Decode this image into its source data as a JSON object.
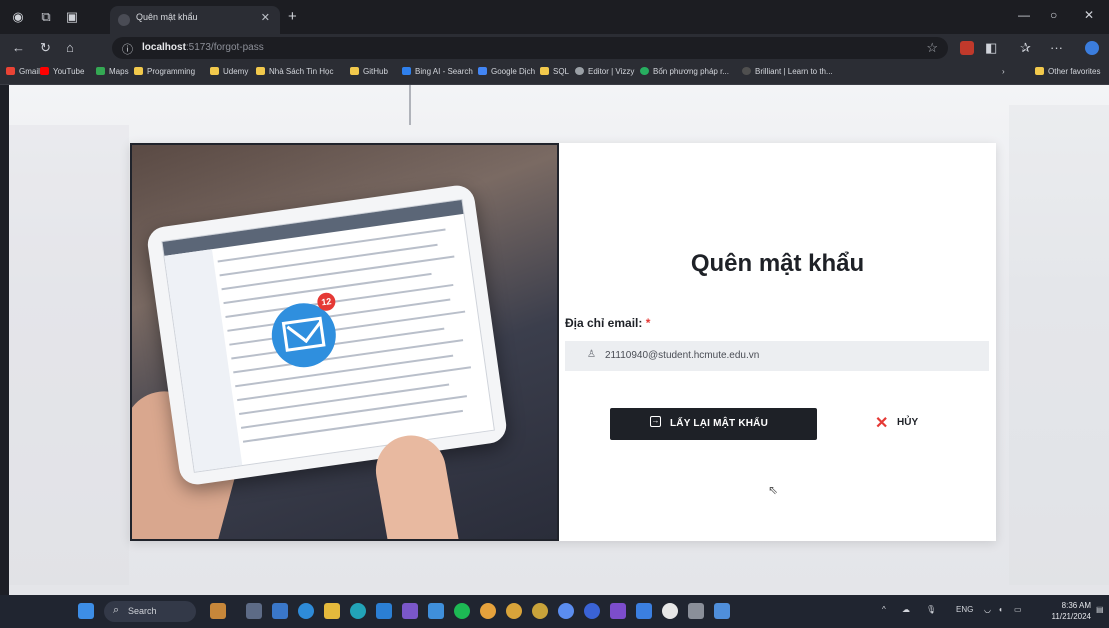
{
  "browser": {
    "tab_title": "Quên mật khẩu",
    "url_host": "localhost",
    "url_path": ":5173/forgot-pass",
    "bookmarks": [
      "Gmail",
      "YouTube",
      "Maps",
      "Programming",
      "Udemy",
      "Nhà Sách Tin Học",
      "GitHub",
      "Bing AI - Search",
      "Google Dịch",
      "SQL",
      "Editor | Vizzy",
      "Bốn phương pháp r...",
      "Brilliant | Learn to th...",
      "Other favorites"
    ]
  },
  "form": {
    "heading": "Quên mật khẩu",
    "email_label": "Địa chỉ email:",
    "required_mark": "*",
    "email_value": "21110940@student.hcmute.edu.vn",
    "submit_label": "LẤY LẠI MẬT KHẨU",
    "cancel_label": "HỦY",
    "cancel_icon": "✕"
  },
  "illustration": {
    "notification_count": "12"
  },
  "taskbar": {
    "search_label": "Search",
    "lang": "ENG",
    "time": "8:36 AM",
    "date": "11/21/2024"
  },
  "colors": {
    "accent_dark": "#1e2127",
    "danger": "#e53935",
    "mail_blue": "#2f8fde"
  }
}
